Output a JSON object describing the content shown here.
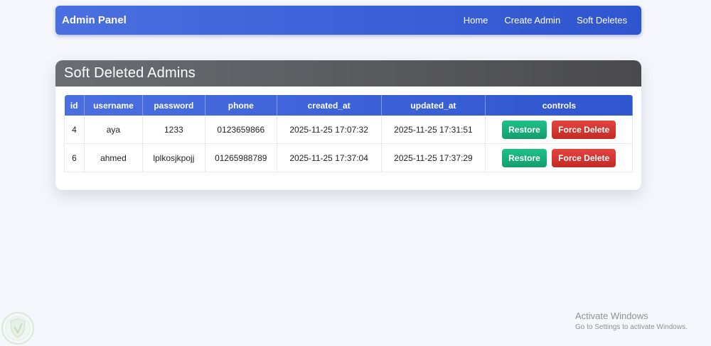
{
  "navbar": {
    "brand": "Admin Panel",
    "links": [
      "Home",
      "Create Admin",
      "Soft Deletes"
    ]
  },
  "card": {
    "title": "Soft Deleted Admins"
  },
  "table": {
    "headers": [
      "id",
      "username",
      "password",
      "phone",
      "created_at",
      "updated_at",
      "controls"
    ],
    "rows": [
      {
        "id": "4",
        "username": "aya",
        "password": "1233",
        "phone": "0123659866",
        "created_at": "2025-11-25 17:07:32",
        "updated_at": "2025-11-25 17:31:51",
        "restore_label": "Restore",
        "force_label": "Force Delete"
      },
      {
        "id": "6",
        "username": "ahmed",
        "password": "lplkosjkpojj",
        "phone": "01265988789",
        "created_at": "2025-11-25 17:37:04",
        "updated_at": "2025-11-25 17:37:29",
        "restore_label": "Restore",
        "force_label": "Force Delete"
      }
    ]
  },
  "watermark": {
    "title": "Activate Windows",
    "subtitle": "Go to Settings to activate Windows."
  },
  "colors": {
    "primary": "#3a5fd8",
    "header_dark": "#5a5b5f",
    "restore": "#18b07c",
    "force_delete": "#d8372f",
    "background": "#f5f7fc"
  },
  "icons": {
    "corner": "shield-logo-icon"
  }
}
